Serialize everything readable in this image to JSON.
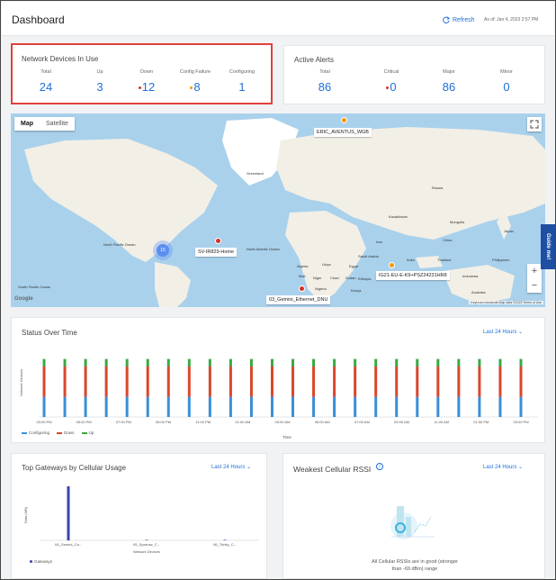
{
  "header": {
    "title": "Dashboard",
    "refresh_label": "Refresh",
    "as_of": "As of: Jan 4, 2023 2:57 PM"
  },
  "devices": {
    "title": "Network Devices In Use",
    "stats": [
      {
        "label": "Total",
        "value": "24",
        "dot": ""
      },
      {
        "label": "Up",
        "value": "3",
        "dot": ""
      },
      {
        "label": "Down",
        "value": "12",
        "dot": "#d93025"
      },
      {
        "label": "Config Failure",
        "value": "8",
        "dot": "#f29900"
      },
      {
        "label": "Configuring",
        "value": "1",
        "dot": ""
      }
    ]
  },
  "alerts": {
    "title": "Active Alerts",
    "stats": [
      {
        "label": "Total",
        "value": "86",
        "dot": ""
      },
      {
        "label": "Critical",
        "value": "0",
        "dot": "#d93025"
      },
      {
        "label": "Major",
        "value": "86",
        "dot": ""
      },
      {
        "label": "Minor",
        "value": "0",
        "dot": ""
      }
    ]
  },
  "map": {
    "tabs": [
      "Map",
      "Satellite"
    ],
    "markers": [
      {
        "label": "ERIC_AVENTUS_WGB",
        "color": "#f29900"
      },
      {
        "label": "SV-IR829-Home",
        "color": "#d93025"
      },
      {
        "label": "IG21-EU-E-K9+PSZ24231HR8",
        "color": "#f29900"
      },
      {
        "label": "03_Gemini_Ethernet_DNU",
        "color": "#d93025"
      }
    ],
    "cluster_count": "15",
    "places": [
      "Greenland",
      "North Pacific Ocean",
      "North Atlantic Ocean",
      "South Pacific Ocean",
      "Algeria",
      "Libya",
      "Egypt",
      "Niger",
      "Chad",
      "Sudan",
      "Nigeria",
      "India",
      "China",
      "Mongolia",
      "Kazakhstan",
      "Iran",
      "Saudi Arabia",
      "Thailand",
      "Russia",
      "Ethiopia",
      "Kenya",
      "Mali",
      "Philippines",
      "Japan",
      "Indonesia",
      "Australia"
    ],
    "attribution": "Keyboard shortcuts   Map data ©2023   Terms of Use",
    "zoom_in": "+",
    "zoom_out": "−",
    "guide": "Guide me!",
    "google": "Google"
  },
  "status_chart": {
    "title": "Status Over Time",
    "range": "Last 24 Hours",
    "ylabel": "Network Devices",
    "xlabel": "Time",
    "legend": [
      "Configuring",
      "Down",
      "Up"
    ],
    "colors": {
      "Configuring": "#3a8fd6",
      "Down": "#d9472b",
      "Up": "#3aa845"
    }
  },
  "chart_data": [
    {
      "type": "bar",
      "title": "Status Over Time",
      "xlabel": "Time",
      "ylabel": "Network Devices",
      "categories": [
        "03:00 PM",
        "05:00 PM",
        "07:00 PM",
        "09:00 PM",
        "11:00 PM",
        "01:00 AM",
        "03:00 AM",
        "05:00 AM",
        "07:00 AM",
        "09:00 AM",
        "11:00 AM",
        "01:00 PM",
        "03:00 PM"
      ],
      "series": [
        {
          "name": "Configuring",
          "values": [
            8,
            8,
            8,
            8,
            8,
            8,
            8,
            8,
            8,
            8,
            8,
            8,
            8,
            8,
            8,
            8,
            8,
            8,
            8,
            8,
            8,
            8,
            8,
            8
          ]
        },
        {
          "name": "Down",
          "values": [
            12,
            12,
            12,
            12,
            12,
            12,
            12,
            12,
            12,
            12,
            12,
            12,
            12,
            12,
            12,
            12,
            12,
            12,
            12,
            12,
            12,
            12,
            12,
            12
          ]
        },
        {
          "name": "Up",
          "values": [
            3,
            3,
            3,
            3,
            3,
            3,
            3,
            3,
            3,
            3,
            3,
            3,
            3,
            3,
            3,
            3,
            3,
            3,
            3,
            3,
            3,
            3,
            3,
            3
          ]
        }
      ]
    },
    {
      "type": "bar",
      "title": "Top Gateways by Cellular Usage",
      "xlabel": "Network Devices",
      "ylabel": "Data (MB)",
      "categories": [
        "04_Gemini_Ca...",
        "05_Sparrow_C...",
        "06_Trinity_C..."
      ],
      "series": [
        {
          "name": "Gateways",
          "values": [
            7.5,
            0.05,
            0.03
          ]
        }
      ]
    }
  ],
  "gateways": {
    "title": "Top Gateways by Cellular Usage",
    "range": "Last 24 Hours",
    "legend": "Gateways"
  },
  "rssi": {
    "title": "Weakest Cellular RSSI",
    "range": "Last 24 Hours",
    "message": "All Cellular RSSIs are in good (stronger than -69 dBm) range"
  }
}
